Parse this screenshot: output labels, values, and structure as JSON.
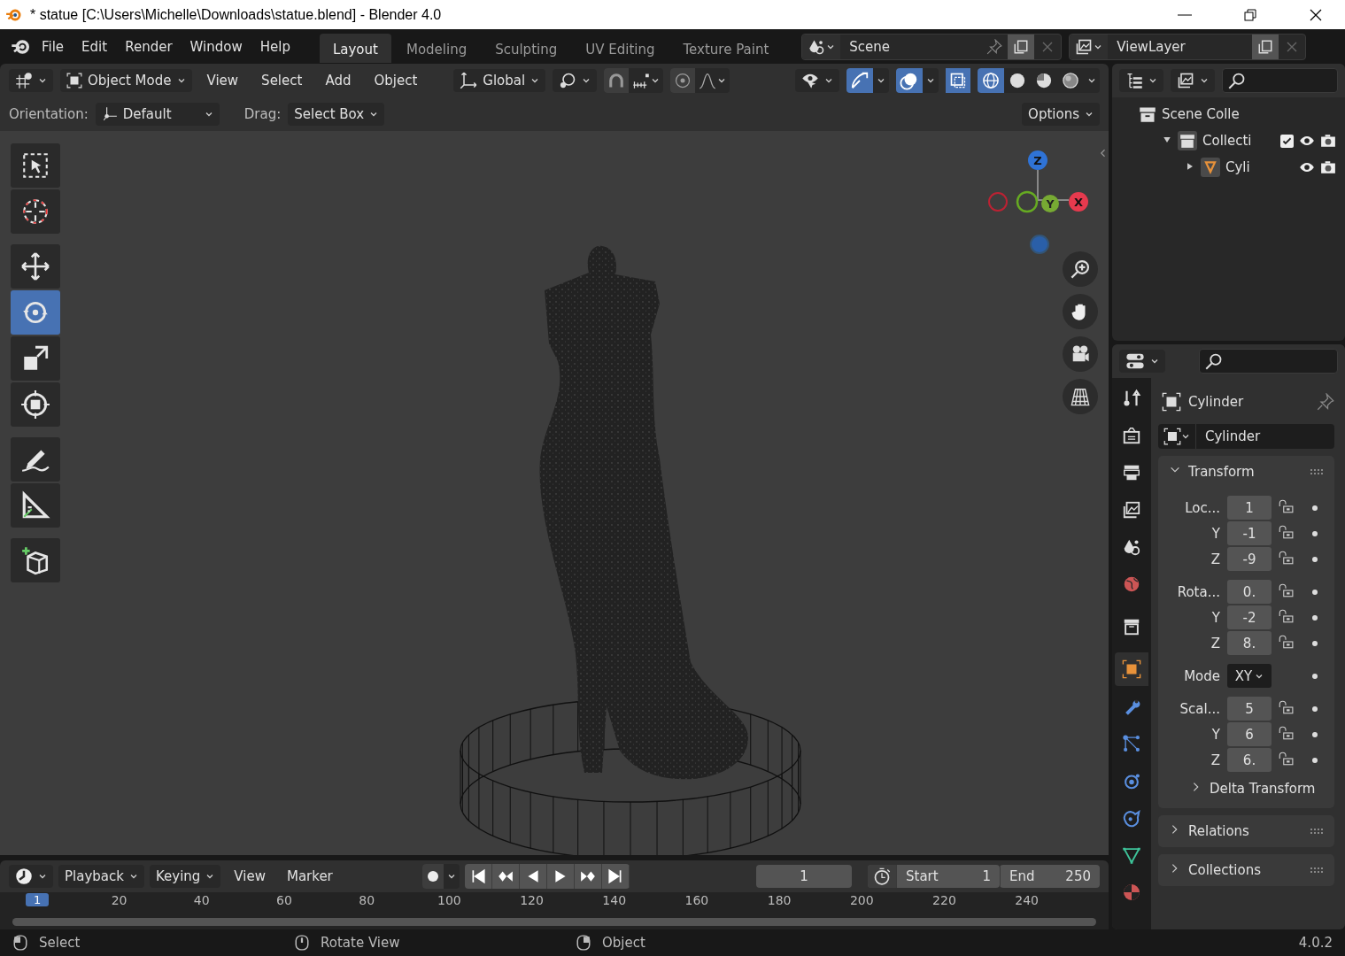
{
  "title_bar": {
    "title": "* statue [C:\\Users\\Michelle\\Downloads\\statue.blend] - Blender 4.0"
  },
  "top_bar": {
    "menus": [
      "File",
      "Edit",
      "Render",
      "Window",
      "Help"
    ],
    "workspaces": [
      {
        "label": "Layout",
        "selected": true
      },
      {
        "label": "Modeling",
        "selected": false
      },
      {
        "label": "Sculpting",
        "selected": false
      },
      {
        "label": "UV Editing",
        "selected": false
      },
      {
        "label": "Texture Paint",
        "selected": false
      }
    ],
    "scene": "Scene",
    "view_layer": "ViewLayer"
  },
  "viewport_header": {
    "mode": "Object Mode",
    "menus": [
      "View",
      "Select",
      "Add",
      "Object"
    ],
    "orientation": "Global",
    "snap": {
      "on": false
    },
    "proportional": {
      "on": false
    },
    "gizmos": {
      "on": true
    },
    "overlays": {
      "on": true
    },
    "xray": {
      "on": true
    },
    "shading": [
      {
        "kind": "wireframe",
        "selected": true
      },
      {
        "kind": "solid",
        "selected": false
      },
      {
        "kind": "material",
        "selected": false
      },
      {
        "kind": "rendered",
        "selected": false
      }
    ]
  },
  "tool_settings": {
    "orientation_label": "Orientation:",
    "orientation": "Default",
    "drag_label": "Drag:",
    "drag": "Select Box",
    "options": "Options"
  },
  "tools": [
    {
      "kind": "select_box",
      "selected": false
    },
    {
      "kind": "cursor",
      "selected": false
    },
    {
      "kind": "move",
      "selected": false
    },
    {
      "kind": "rotate",
      "selected": true
    },
    {
      "kind": "scale",
      "selected": false
    },
    {
      "kind": "transform",
      "selected": false
    },
    {
      "kind": "annotate",
      "selected": false
    },
    {
      "kind": "measure",
      "selected": false
    },
    {
      "kind": "add_cube",
      "selected": false
    }
  ],
  "gizmo": {
    "z": "Z",
    "x": "X",
    "y": "Y"
  },
  "outliner": {
    "items": [
      {
        "label": "Scene Colle",
        "kind": "scene_collection",
        "children": [
          {
            "label": "Collecti",
            "kind": "collection",
            "expanded": true,
            "checked": true,
            "children": [
              {
                "label": "Cyli",
                "kind": "mesh",
                "expanded": false
              }
            ]
          }
        ]
      }
    ]
  },
  "properties": {
    "tabs": [
      {
        "kind": "tool",
        "selected": false
      },
      {
        "kind": "render",
        "selected": false
      },
      {
        "kind": "output",
        "selected": false
      },
      {
        "kind": "view_layer",
        "selected": false
      },
      {
        "kind": "scene",
        "selected": false
      },
      {
        "kind": "world",
        "selected": false
      },
      {
        "kind": "collection",
        "selected": false
      },
      {
        "kind": "object",
        "selected": true
      },
      {
        "kind": "modifiers",
        "selected": false
      },
      {
        "kind": "particles",
        "selected": false
      },
      {
        "kind": "physics",
        "selected": false
      },
      {
        "kind": "constraints",
        "selected": false
      },
      {
        "kind": "data",
        "selected": false
      },
      {
        "kind": "material",
        "selected": false
      }
    ],
    "object_name": "Cylinder",
    "name_field": "Cylinder",
    "transform": {
      "title": "Transform",
      "expanded": true,
      "groups": [
        {
          "rows": [
            {
              "label": "Loc...",
              "kind": "number",
              "value": "1",
              "locked": false
            },
            {
              "label": "Y",
              "kind": "number",
              "value": "-1",
              "locked": false
            },
            {
              "label": "Z",
              "kind": "number",
              "value": "-9",
              "locked": false
            }
          ]
        },
        {
          "rows": [
            {
              "label": "Rota...",
              "kind": "number",
              "value": "0.",
              "locked": false
            },
            {
              "label": "Y",
              "kind": "number",
              "value": "-2",
              "locked": false
            },
            {
              "label": "Z",
              "kind": "number",
              "value": "8.",
              "locked": false
            }
          ]
        },
        {
          "rows": [
            {
              "label": "Mode",
              "kind": "dropdown",
              "value": "XY"
            }
          ]
        },
        {
          "rows": [
            {
              "label": "Scal...",
              "kind": "number",
              "value": "5",
              "locked": false
            },
            {
              "label": "Y",
              "kind": "number",
              "value": "6",
              "locked": false
            },
            {
              "label": "Z",
              "kind": "number",
              "value": "6.",
              "locked": false
            }
          ]
        }
      ],
      "subpanel": {
        "title": "Delta Transform",
        "expanded": false
      }
    },
    "panels": [
      {
        "title": "Relations",
        "expanded": false
      },
      {
        "title": "Collections",
        "expanded": false
      }
    ]
  },
  "timeline": {
    "menus": [
      "Playback",
      "Keying",
      "View",
      "Marker"
    ],
    "auto_keying": {
      "on": false
    },
    "current_frame": "1",
    "start_label": "Start",
    "start": "1",
    "end_label": "End",
    "end": "250",
    "marker": "1",
    "ticks": [
      "20",
      "40",
      "60",
      "80",
      "100",
      "120",
      "140",
      "160",
      "180",
      "200",
      "220",
      "240"
    ]
  },
  "status_bar": {
    "items": [
      {
        "kind": "left_click",
        "label": "Select"
      },
      {
        "kind": "middle_click",
        "label": "Rotate View"
      },
      {
        "kind": "right_click",
        "label": "Object"
      }
    ],
    "version": "4.0.2"
  }
}
